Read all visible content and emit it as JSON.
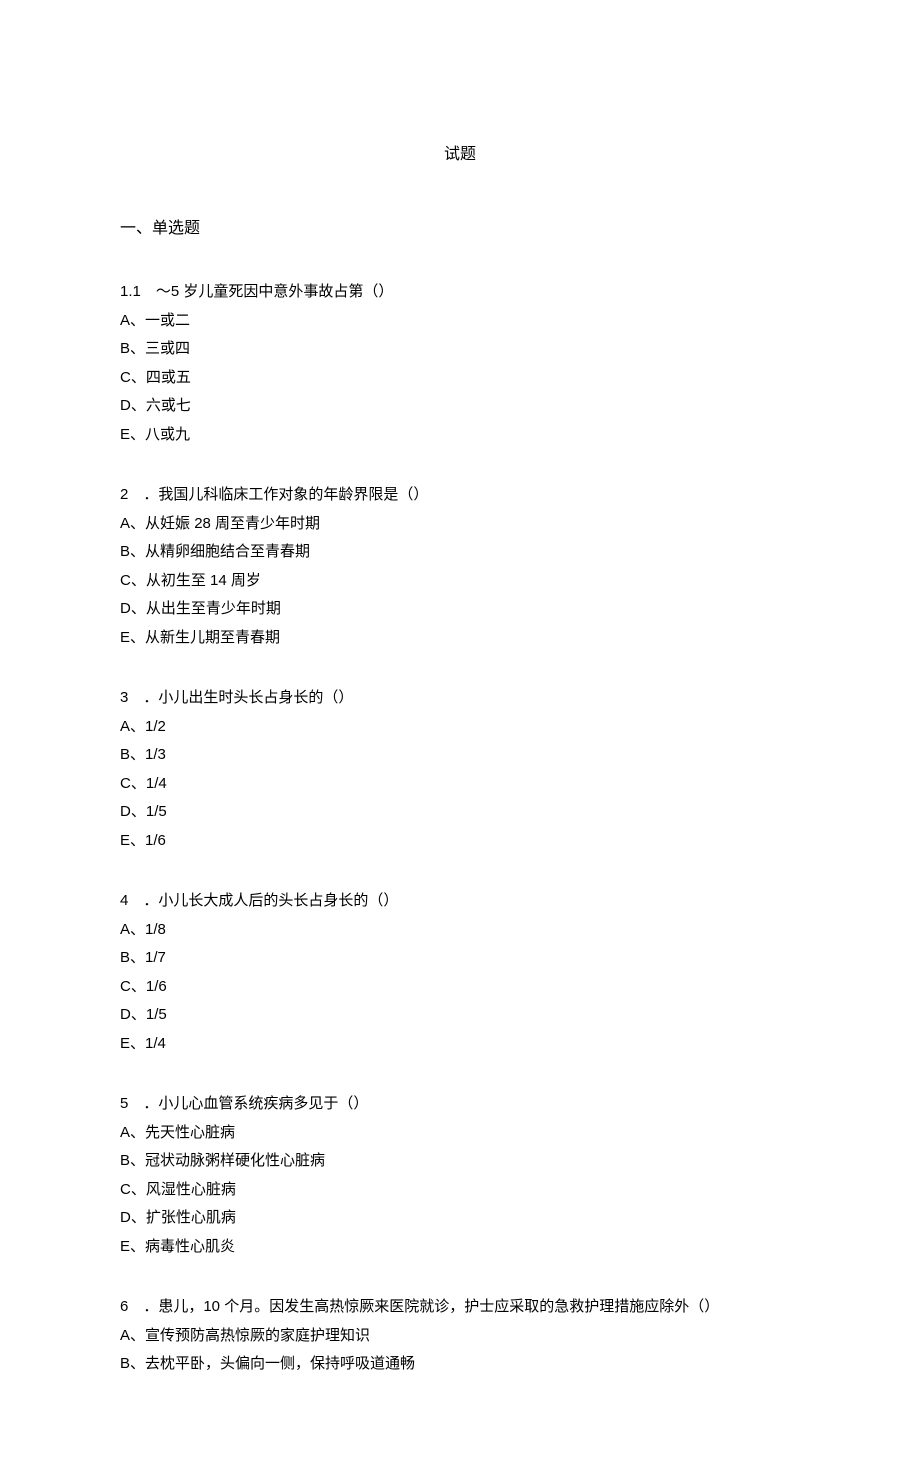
{
  "title": "试题",
  "section_heading": "一、单选题",
  "questions": [
    {
      "number": "1.1",
      "text": "～5 岁儿童死因中意外事故占第（）",
      "options": [
        {
          "letter": "A",
          "text": "一或二"
        },
        {
          "letter": "B",
          "text": "三或四"
        },
        {
          "letter": "C",
          "text": "四或五"
        },
        {
          "letter": "D",
          "text": "六或七"
        },
        {
          "letter": "E",
          "text": "八或九"
        }
      ]
    },
    {
      "number": "2",
      "text": "．我国儿科临床工作对象的年龄界限是（）",
      "options": [
        {
          "letter": "A",
          "text": "从妊娠 28 周至青少年时期"
        },
        {
          "letter": "B",
          "text": "从精卵细胞结合至青春期"
        },
        {
          "letter": "C",
          "text": "从初生至 14 周岁"
        },
        {
          "letter": "D",
          "text": "从出生至青少年时期"
        },
        {
          "letter": "E",
          "text": "从新生儿期至青春期"
        }
      ]
    },
    {
      "number": "3",
      "text": "．小儿出生时头长占身长的（）",
      "options": [
        {
          "letter": "A",
          "text": "1/2"
        },
        {
          "letter": "B",
          "text": "1/3"
        },
        {
          "letter": "C",
          "text": "1/4"
        },
        {
          "letter": "D",
          "text": "1/5"
        },
        {
          "letter": "E",
          "text": "1/6"
        }
      ]
    },
    {
      "number": "4",
      "text": "．小儿长大成人后的头长占身长的（）",
      "options": [
        {
          "letter": "A",
          "text": "1/8"
        },
        {
          "letter": "B",
          "text": "1/7"
        },
        {
          "letter": "C",
          "text": "1/6"
        },
        {
          "letter": "D",
          "text": "1/5"
        },
        {
          "letter": "E",
          "text": "1/4"
        }
      ]
    },
    {
      "number": "5",
      "text": "．小儿心血管系统疾病多见于（）",
      "options": [
        {
          "letter": "A",
          "text": "先天性心脏病"
        },
        {
          "letter": "B",
          "text": "冠状动脉粥样硬化性心脏病"
        },
        {
          "letter": "C",
          "text": "风湿性心脏病"
        },
        {
          "letter": "D",
          "text": "扩张性心肌病"
        },
        {
          "letter": "E",
          "text": "病毒性心肌炎"
        }
      ]
    },
    {
      "number": "6",
      "text": "．患儿，10 个月。因发生高热惊厥来医院就诊，护士应采取的急救护理措施应除外（）",
      "options": [
        {
          "letter": "A",
          "text": "宣传预防高热惊厥的家庭护理知识"
        },
        {
          "letter": "B",
          "text": "去枕平卧，头偏向一侧，保持呼吸道通畅"
        }
      ]
    }
  ]
}
